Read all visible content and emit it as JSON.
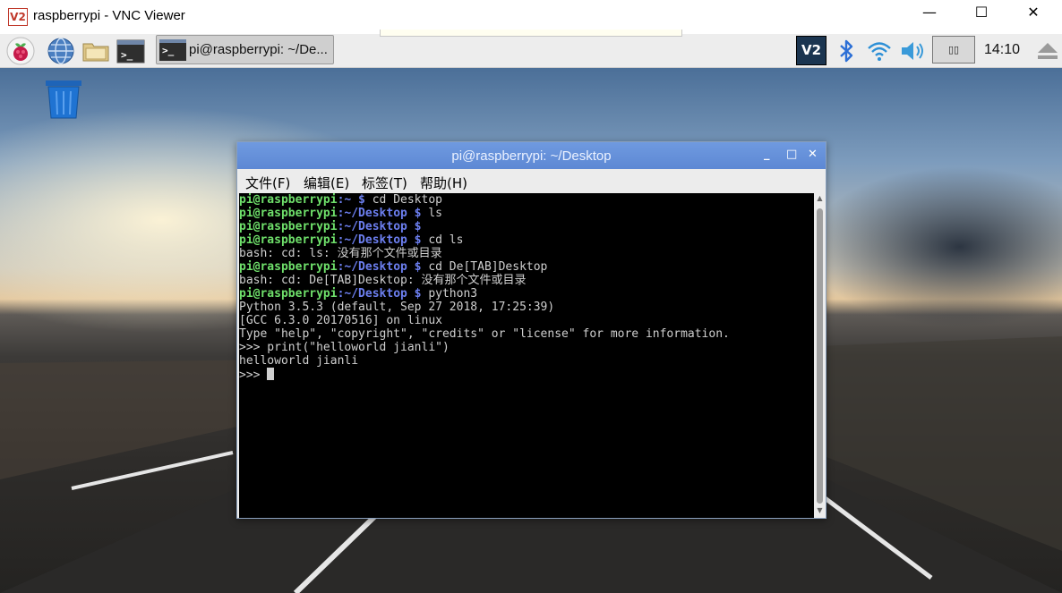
{
  "vnc_window": {
    "logo_text": "V2",
    "title": "raspberrypi - VNC Viewer",
    "minimize": "—",
    "maximize": "☐",
    "close": "✕"
  },
  "panel": {
    "launchers": [
      "raspberry-menu-icon",
      "web-browser-icon",
      "file-manager-icon",
      "terminal-icon"
    ],
    "task_button_label": "pi@raspberrypi: ~/De...",
    "task_button_icon": ">_",
    "tray": {
      "vnc_label": "V2",
      "bluetooth": "bluetooth-icon",
      "wifi": "wifi-icon",
      "volume": "volume-icon",
      "clock": "14:10"
    }
  },
  "terminal": {
    "title": "pi@raspberrypi: ~/Desktop",
    "buttons": {
      "minimize": "_",
      "maximize": "□",
      "close": "✕"
    },
    "menu": [
      "文件(F)",
      "编辑(E)",
      "标签(T)",
      "帮助(H)"
    ],
    "lines": [
      {
        "user": "pi@raspberrypi",
        "path": ":~ $",
        "text": " cd Desktop"
      },
      {
        "user": "pi@raspberrypi",
        "path": ":~/Desktop $",
        "text": " ls"
      },
      {
        "user": "pi@raspberrypi",
        "path": ":~/Desktop $",
        "text": ""
      },
      {
        "user": "pi@raspberrypi",
        "path": ":~/Desktop $",
        "text": " cd ls"
      },
      {
        "user": "",
        "path": "",
        "text": "bash: cd: ls: 没有那个文件或目录"
      },
      {
        "user": "pi@raspberrypi",
        "path": ":~/Desktop $",
        "text": " cd De[TAB]Desktop"
      },
      {
        "user": "",
        "path": "",
        "text": "bash: cd: De[TAB]Desktop: 没有那个文件或目录"
      },
      {
        "user": "pi@raspberrypi",
        "path": ":~/Desktop $",
        "text": " python3"
      },
      {
        "user": "",
        "path": "",
        "text": "Python 3.5.3 (default, Sep 27 2018, 17:25:39)"
      },
      {
        "user": "",
        "path": "",
        "text": "[GCC 6.3.0 20170516] on linux"
      },
      {
        "user": "",
        "path": "",
        "text": "Type \"help\", \"copyright\", \"credits\" or \"license\" for more information."
      },
      {
        "user": "",
        "path": "",
        "text": ">>> print(\"helloworld jianli\")"
      },
      {
        "user": "",
        "path": "",
        "text": "helloworld jianli"
      }
    ],
    "prompt": ">>> "
  }
}
